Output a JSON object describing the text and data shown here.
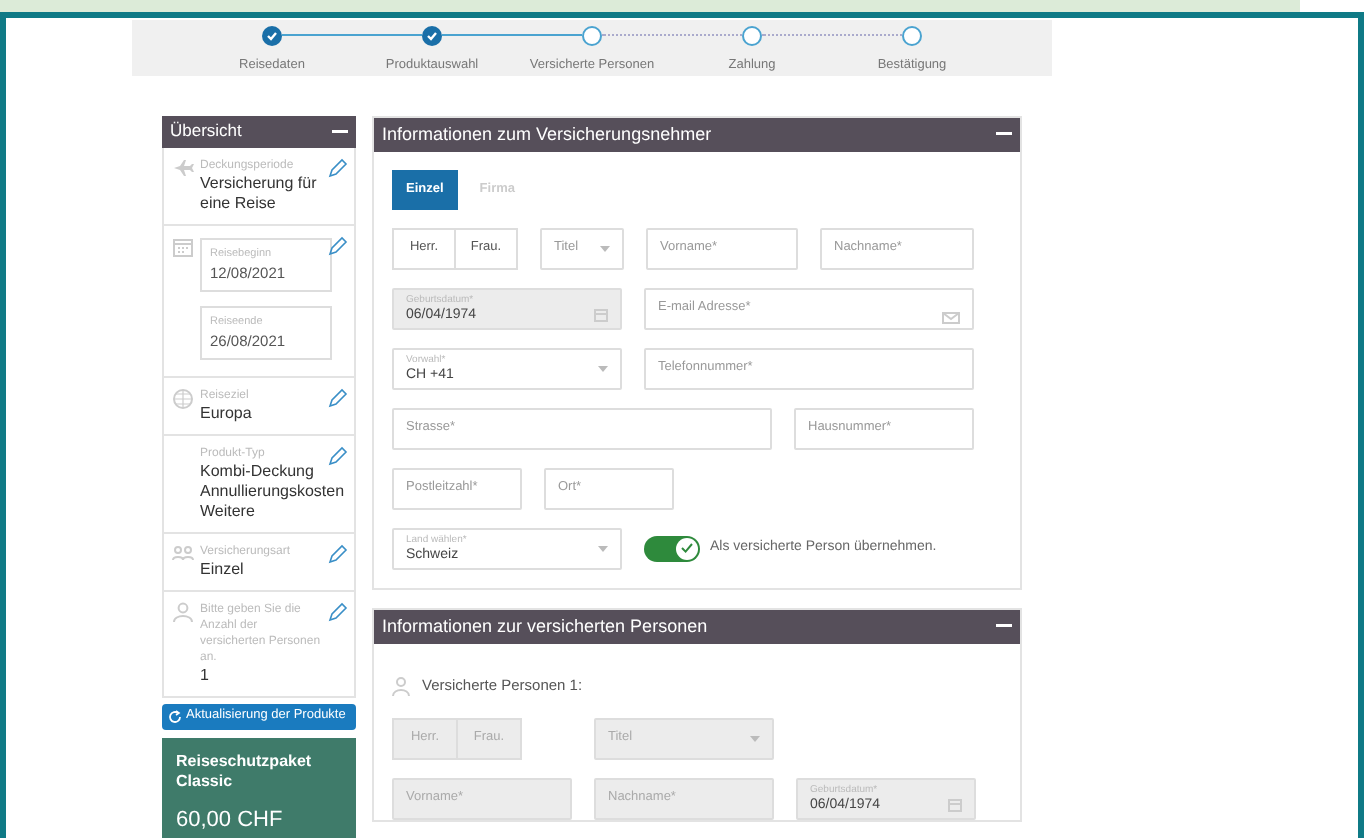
{
  "steps": [
    {
      "label": "Reisedaten",
      "completed": true
    },
    {
      "label": "Produktauswahl",
      "completed": true
    },
    {
      "label": "Versicherte Personen",
      "completed": false
    },
    {
      "label": "Zahlung",
      "completed": false
    },
    {
      "label": "Bestätigung",
      "completed": false
    }
  ],
  "sidebar": {
    "title": "Übersicht",
    "items": [
      {
        "kind": "text",
        "label": "Deckungsperiode",
        "value": "Versicherung für eine Reise"
      },
      {
        "kind": "dates",
        "fields": [
          {
            "label": "Reisebeginn",
            "value": "12/08/2021"
          },
          {
            "label": "Reiseende",
            "value": "26/08/2021"
          }
        ]
      },
      {
        "kind": "text",
        "label": "Reiseziel",
        "value": "Europa"
      },
      {
        "kind": "text",
        "label": "Produkt-Typ",
        "value": "Kombi-Deckung Annullierungskosten Weitere"
      },
      {
        "kind": "text",
        "label": "Versicherungsart",
        "value": "Einzel"
      },
      {
        "kind": "text",
        "label": "Bitte geben Sie die Anzahl der versicherten Personen an.",
        "value": "1"
      }
    ],
    "refresh_button": "Aktualisierung der Produkte",
    "package": {
      "name": "Reiseschutzpaket Classic",
      "price": "60,00 CHF"
    }
  },
  "policyholder": {
    "title": "Informationen zum Versicherungsnehmer",
    "tabs": [
      {
        "label": "Einzel",
        "selected": true
      },
      {
        "label": "Firma",
        "selected": false
      }
    ],
    "fields": [
      {
        "kind": "salutation",
        "disabled": false,
        "options": [
          {
            "label": "Herr.",
            "selected": false
          },
          {
            "label": "Frau.",
            "selected": false
          }
        ]
      },
      {
        "kind": "select",
        "disabled": false,
        "placeholder": "Titel"
      },
      {
        "kind": "text",
        "disabled": false,
        "placeholder": "Vorname*"
      },
      {
        "kind": "text",
        "disabled": false,
        "placeholder": "Nachname*"
      },
      {
        "kind": "date",
        "disabled": true,
        "label": "Geburtsdatum*",
        "value": "06/04/1974"
      },
      {
        "kind": "email",
        "disabled": false,
        "placeholder": "E-mail Adresse*"
      },
      {
        "kind": "select",
        "disabled": false,
        "label": "Vorwahl*",
        "value": "CH +41"
      },
      {
        "kind": "text",
        "disabled": false,
        "placeholder": "Telefonnummer*"
      },
      {
        "kind": "text",
        "disabled": false,
        "placeholder": "Strasse*"
      },
      {
        "kind": "text",
        "disabled": false,
        "placeholder": "Hausnummer*"
      },
      {
        "kind": "text",
        "disabled": false,
        "placeholder": "Postleitzahl*"
      },
      {
        "kind": "text",
        "disabled": false,
        "placeholder": "Ort*"
      },
      {
        "kind": "select",
        "disabled": false,
        "label": "Land wählen*",
        "value": "Schweiz"
      }
    ],
    "toggle": {
      "on": true,
      "label": "Als versicherte Person übernehmen."
    }
  },
  "insured": {
    "title": "Informationen zur versicherten Personen",
    "person_label": "Versicherte Personen 1:",
    "fields": [
      {
        "kind": "salutation",
        "disabled": true,
        "options": [
          {
            "label": "Herr.",
            "selected": false
          },
          {
            "label": "Frau.",
            "selected": false
          }
        ]
      },
      {
        "kind": "select",
        "disabled": true,
        "placeholder": "Titel"
      },
      {
        "kind": "text",
        "disabled": true,
        "placeholder": "Vorname*"
      },
      {
        "kind": "text",
        "disabled": true,
        "placeholder": "Nachname*"
      },
      {
        "kind": "date",
        "disabled": true,
        "label": "Geburtsdatum*",
        "value": "06/04/1974"
      }
    ]
  }
}
